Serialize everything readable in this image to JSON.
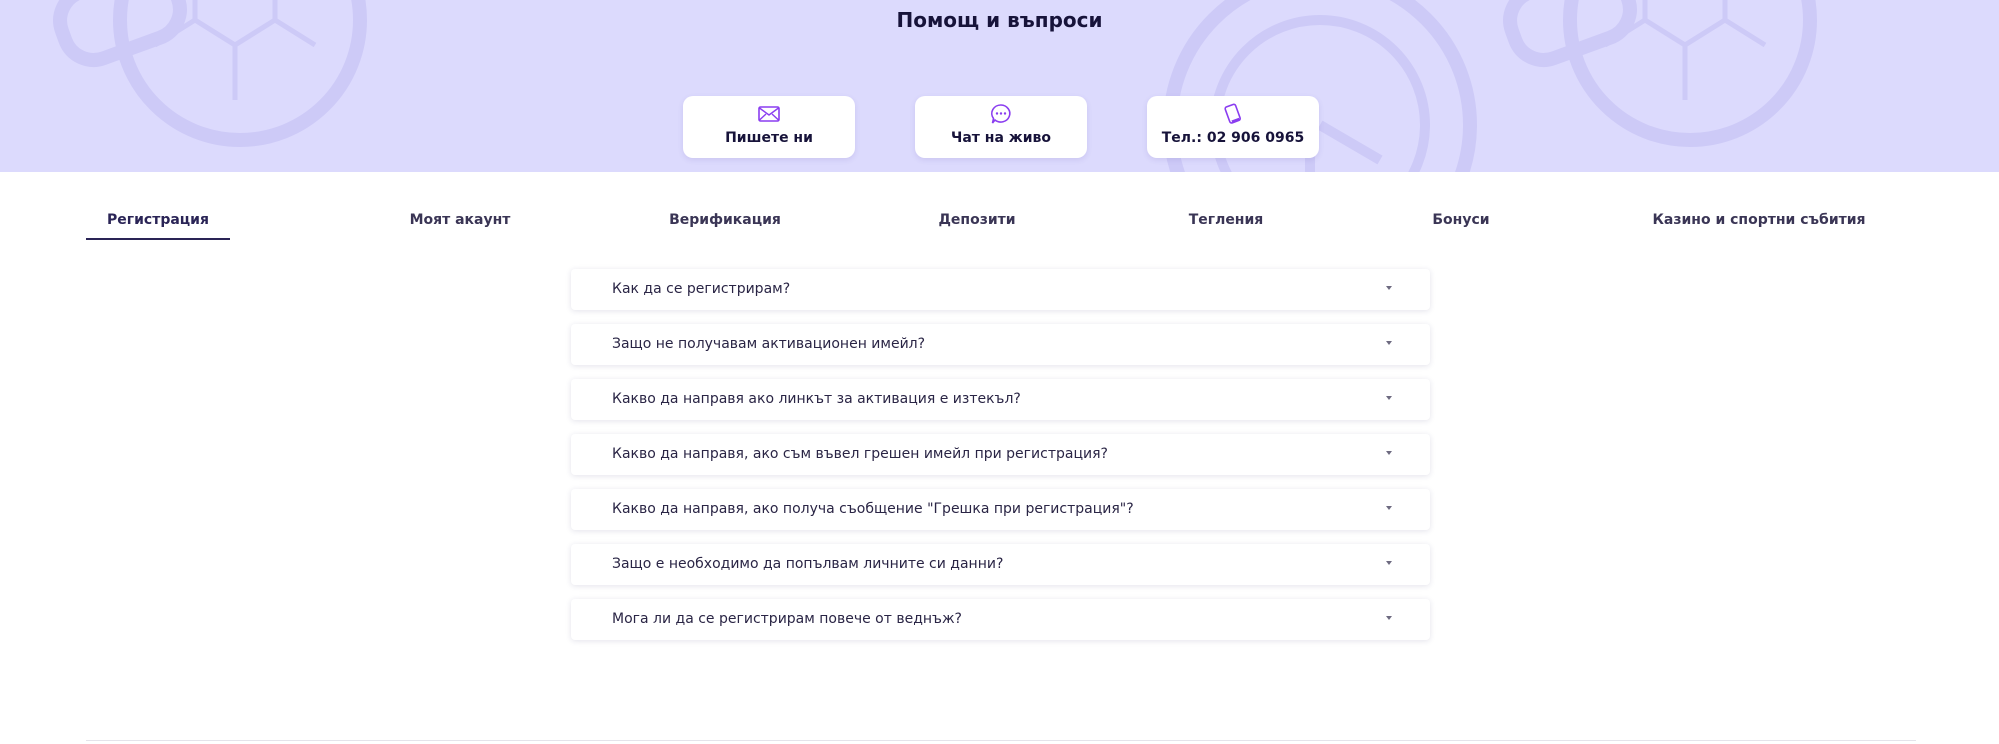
{
  "hero": {
    "title": "Помощ и въпроси",
    "background_color": "#dcdafd",
    "contacts": [
      {
        "label": "Пишете ни",
        "icon": "envelope-icon"
      },
      {
        "label": "Чат на живо",
        "icon": "chat-bubble-icon"
      },
      {
        "label": "Тел.: 02 906 0965",
        "icon": "phone-icon"
      }
    ]
  },
  "tabs": [
    {
      "label": "Регистрация",
      "active": true
    },
    {
      "label": "Моят акаунт",
      "active": false
    },
    {
      "label": "Верификация",
      "active": false
    },
    {
      "label": "Депозити",
      "active": false
    },
    {
      "label": "Тегления",
      "active": false
    },
    {
      "label": "Бонуси",
      "active": false
    },
    {
      "label": "Казино и спортни събития",
      "active": false
    }
  ],
  "faq": [
    {
      "question": "Как да се регистрирам?"
    },
    {
      "question": "Защо не получавам активационен имейл?"
    },
    {
      "question": "Какво да направя ако линкът за активация е изтекъл?"
    },
    {
      "question": "Какво да направя, ако съм въвел грешен имейл при регистрация?"
    },
    {
      "question": "Какво да направя, ако получа съобщение \"Грешка при регистрация\"?"
    },
    {
      "question": "Защо е необходимо да попълвам личните си данни?"
    },
    {
      "question": "Мога ли да се регистрирам повече от веднъж?"
    }
  ],
  "colors": {
    "accent": "#8a3df0",
    "text": "#17133a"
  }
}
